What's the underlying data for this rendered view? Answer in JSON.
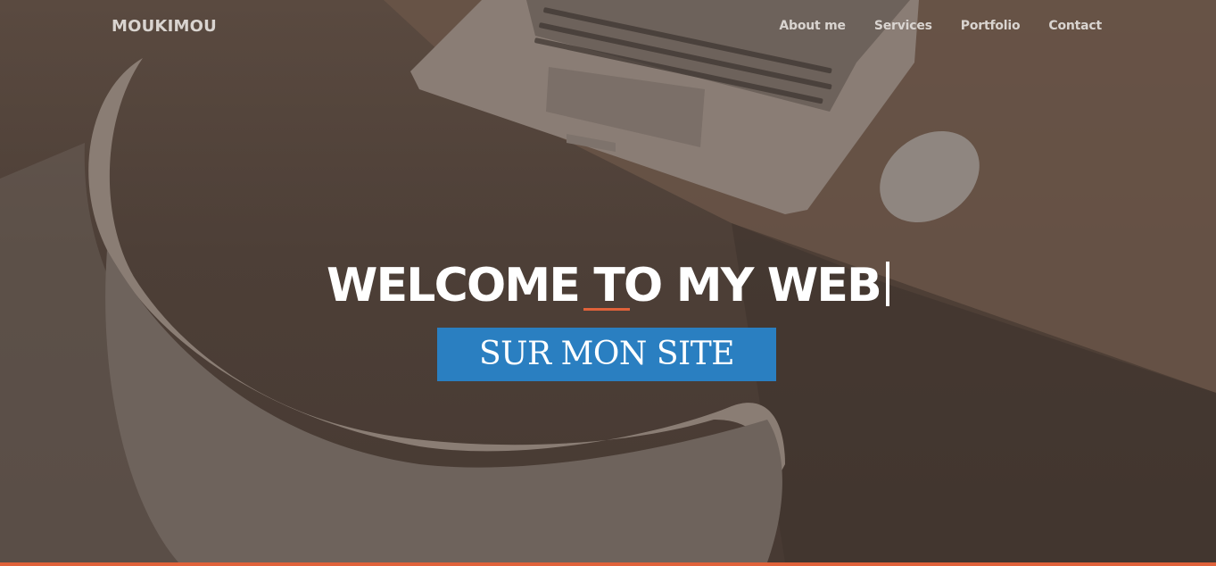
{
  "brand": "MOUKIMOU",
  "nav": {
    "items": [
      {
        "label": "About me"
      },
      {
        "label": "Services"
      },
      {
        "label": "Portfolio"
      },
      {
        "label": "Contact"
      }
    ]
  },
  "hero": {
    "headline": "WELCOME TO MY WEB",
    "cta_label": "SUR MON SITE"
  },
  "colors": {
    "accent": "#e0623a",
    "cta": "#2a7fc1",
    "overlay": "#4a3d36"
  }
}
